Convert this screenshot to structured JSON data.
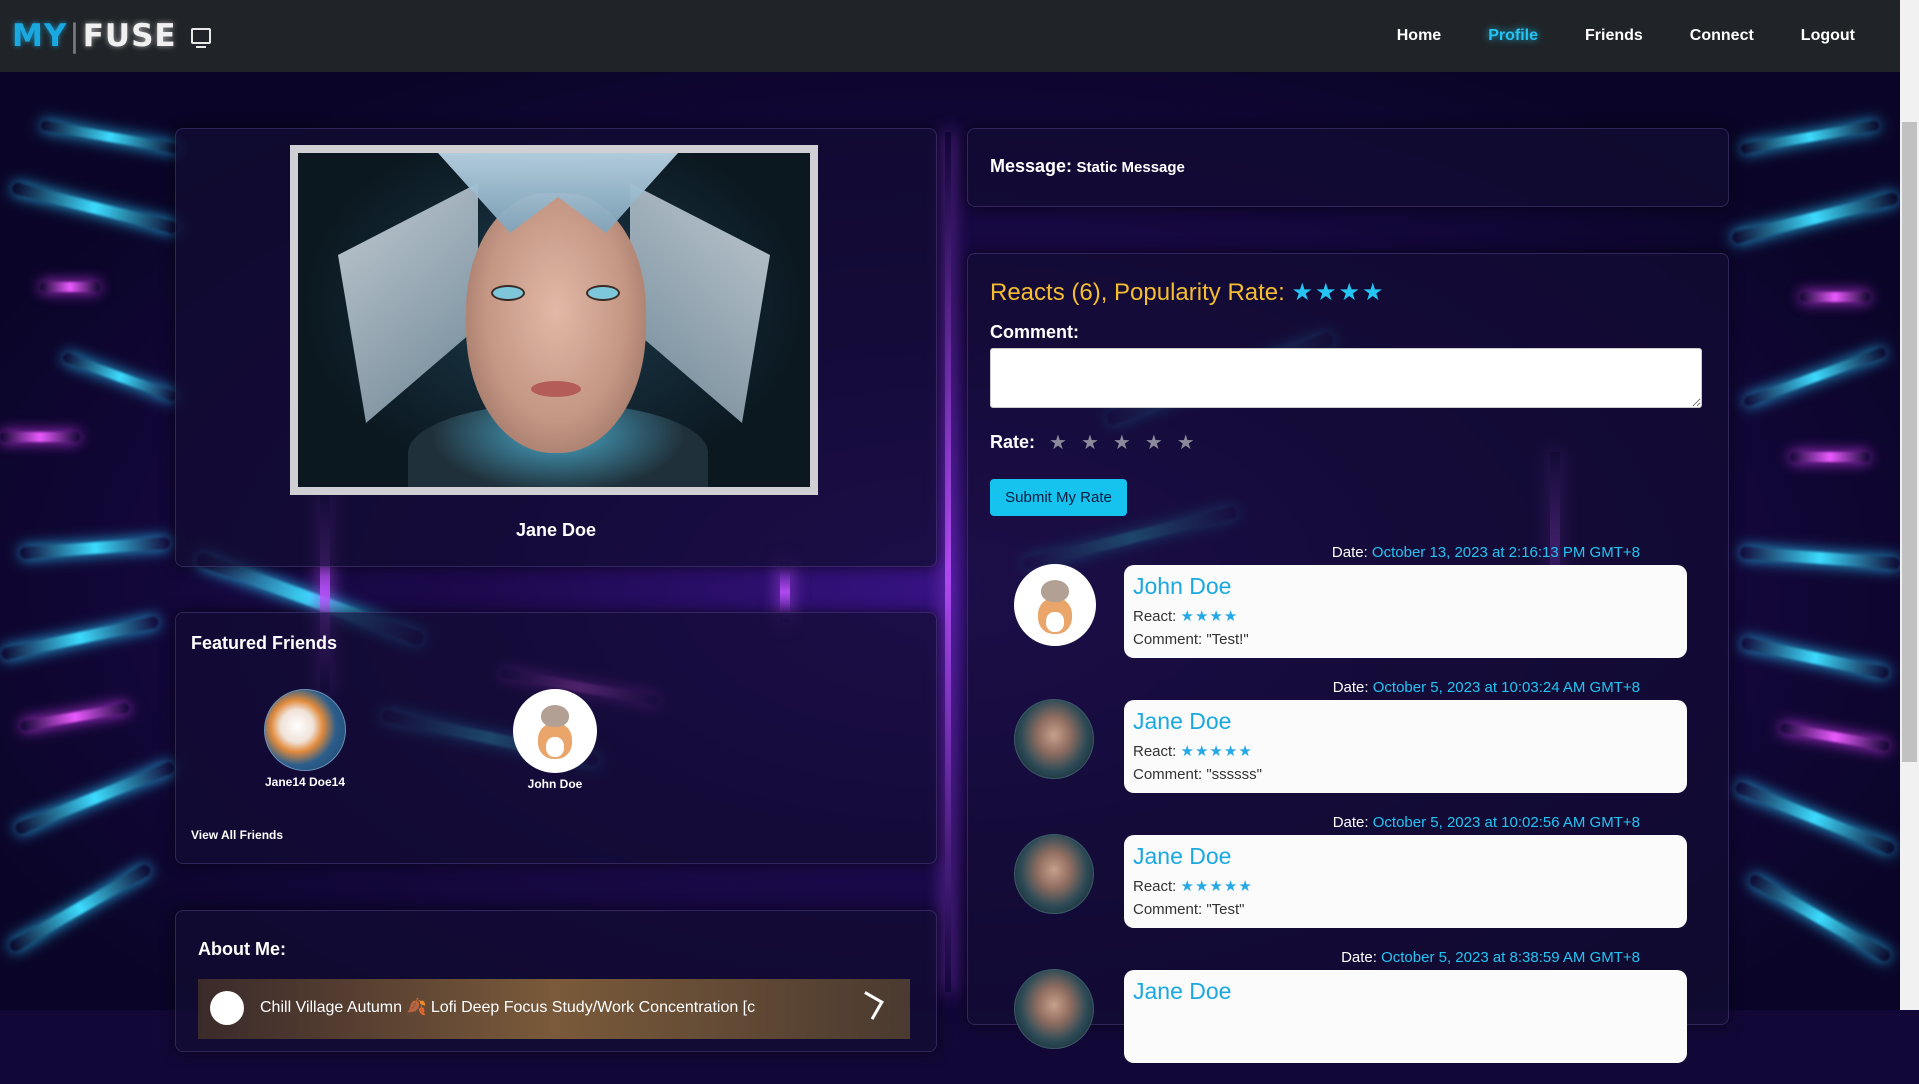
{
  "nav": {
    "logo_my": "MY",
    "logo_sep": "|",
    "logo_fuse": "FUSE",
    "links": [
      "Home",
      "Profile",
      "Friends",
      "Connect",
      "Logout"
    ],
    "active": "Profile"
  },
  "profile": {
    "name": "Jane Doe"
  },
  "featured_friends": {
    "heading": "Featured Friends",
    "friends": [
      {
        "name": "Jane14 Doe14",
        "avatar": "goldfish-avatar"
      },
      {
        "name": "John Doe",
        "avatar": "dog-with-cat-avatar"
      }
    ],
    "view_all": "View All Friends"
  },
  "about": {
    "heading": "About Me:",
    "video_title": "Chill Village Autumn 🍂 Lofi Deep Focus Study/Work Concentration [c"
  },
  "message": {
    "label": "Message:",
    "value": "Static Message"
  },
  "reacts": {
    "reacts_text": "Reacts (6),",
    "popularity_label": "Popularity Rate:",
    "popularity_stars": "★★★★",
    "popularity_rating": 4,
    "comment_label": "Comment:",
    "comment_value": "",
    "rate_label": "Rate:",
    "rate_stars": [
      "★",
      "★",
      "★",
      "★",
      "★"
    ],
    "submit_label": "Submit My Rate"
  },
  "entries": [
    {
      "date_label": "Date:",
      "date": "October 13, 2023 at 2:16:13 PM GMT+8",
      "name": "John Doe",
      "react_label": "React:",
      "react_stars": "★★★★",
      "react_rating": 4,
      "comment": "Comment: \"Test!\"",
      "avatar": "dog-with-cat-avatar"
    },
    {
      "date_label": "Date:",
      "date": "October 5, 2023 at 10:03:24 AM GMT+8",
      "name": "Jane Doe",
      "react_label": "React:",
      "react_stars": "★★★★★",
      "react_rating": 5,
      "comment": "Comment: \"ssssss\"",
      "avatar": "elf-avatar"
    },
    {
      "date_label": "Date:",
      "date": "October 5, 2023 at 10:02:56 AM GMT+8",
      "name": "Jane Doe",
      "react_label": "React:",
      "react_stars": "★★★★★",
      "react_rating": 5,
      "comment": "Comment: \"Test\"",
      "avatar": "elf-avatar"
    },
    {
      "date_label": "Date:",
      "date": "October 5, 2023 at 8:38:59 AM GMT+8",
      "name": "Jane Doe",
      "react_label": "",
      "react_stars": "",
      "comment": "",
      "avatar": "elf-avatar"
    }
  ],
  "colors": {
    "accent": "#24c4f3",
    "reacts_gold": "#f5bd2f",
    "nav_bg": "#202327"
  }
}
